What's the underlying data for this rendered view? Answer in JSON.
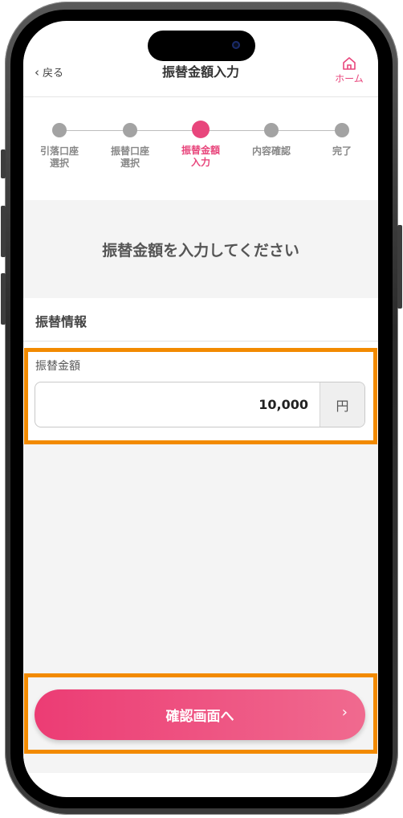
{
  "header": {
    "back_label": "戻る",
    "title": "振替金額入力",
    "home_label": "ホーム"
  },
  "stepper": {
    "steps": [
      {
        "label": "引落口座\n選択",
        "state": "done"
      },
      {
        "label": "振替口座\n選択",
        "state": "done"
      },
      {
        "label": "振替金額\n入力",
        "state": "current"
      },
      {
        "label": "内容確認",
        "state": "todo"
      },
      {
        "label": "完了",
        "state": "todo"
      }
    ]
  },
  "instruction": "振替金額を入力してください",
  "section": {
    "title": "振替情報"
  },
  "form": {
    "amount_label": "振替金額",
    "amount_value": "10,000",
    "unit": "円"
  },
  "cta": {
    "label": "確認画面へ",
    "chevron": "›"
  },
  "colors": {
    "accent": "#e8467c",
    "highlight": "#f28a00"
  },
  "icons": [
    "back-chevron-icon",
    "home-icon",
    "chevron-right-icon"
  ]
}
